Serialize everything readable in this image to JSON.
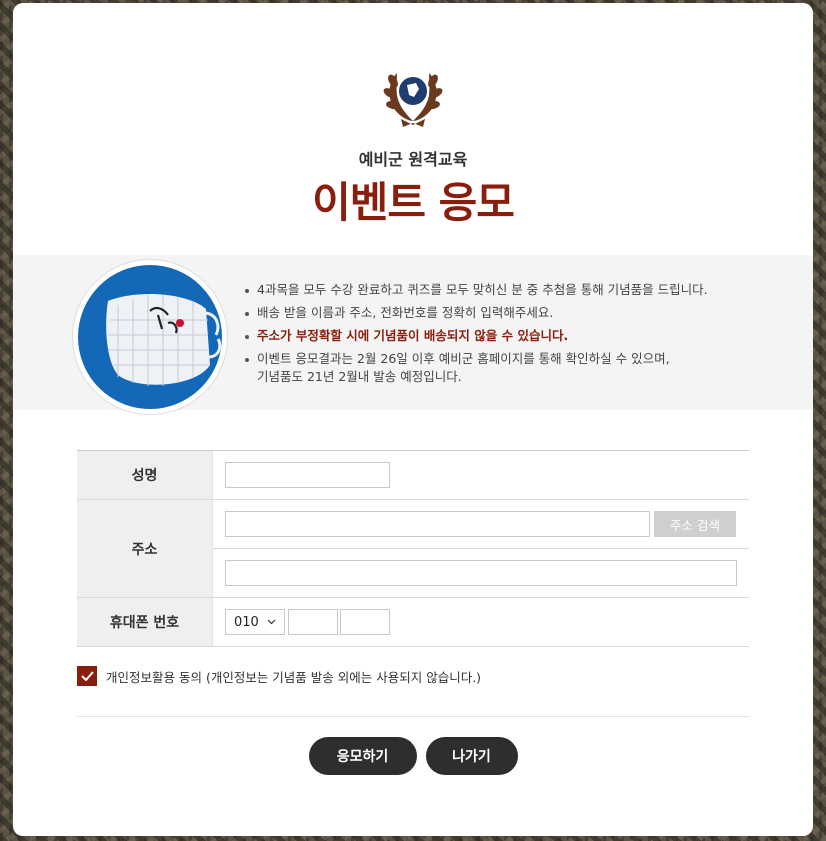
{
  "header": {
    "subtitle": "예비군 원격교육",
    "title": "이벤트 응모",
    "emblem_icon": "laurel-emblem-icon"
  },
  "info": {
    "image_icon": "mask-gift-icon",
    "notes": [
      "4과목을 모두 수강 완료하고 퀴즈를 모두 맞히신 분 중 추첨을 통해 기념품을 드립니다.",
      "배송 받을 이름과 주소, 전화번호를 정확히 입력해주세요.",
      "주소가 부정확할 시에 기념품이 배송되지 않을 수 있습니다.",
      "이벤트 응모결과는 2월 26일 이후 예비군 홈페이지를 통해 확인하실 수 있으며,",
      "기념품도 21년 2월내 발송 예정입니다."
    ]
  },
  "form": {
    "name_label": "성명",
    "address_label": "주소",
    "address_search_label": "주소 검색",
    "phone_label": "휴대폰 번호",
    "phone_prefix": "010",
    "name_value": "",
    "address_value": "",
    "address_detail_value": "",
    "phone_mid_value": "",
    "phone_last_value": ""
  },
  "agreement": {
    "checked": true,
    "label": "개인정보활용 동의 (개인정보는 기념품 발송 외에는 사용되지 않습니다.)"
  },
  "buttons": {
    "submit_label": "응모하기",
    "exit_label": "나가기"
  },
  "colors": {
    "accent": "#8a1e0e",
    "button_dark": "#2e2e2e",
    "band_bg": "#f4f4f4",
    "mask_bg": "#1468b8"
  }
}
